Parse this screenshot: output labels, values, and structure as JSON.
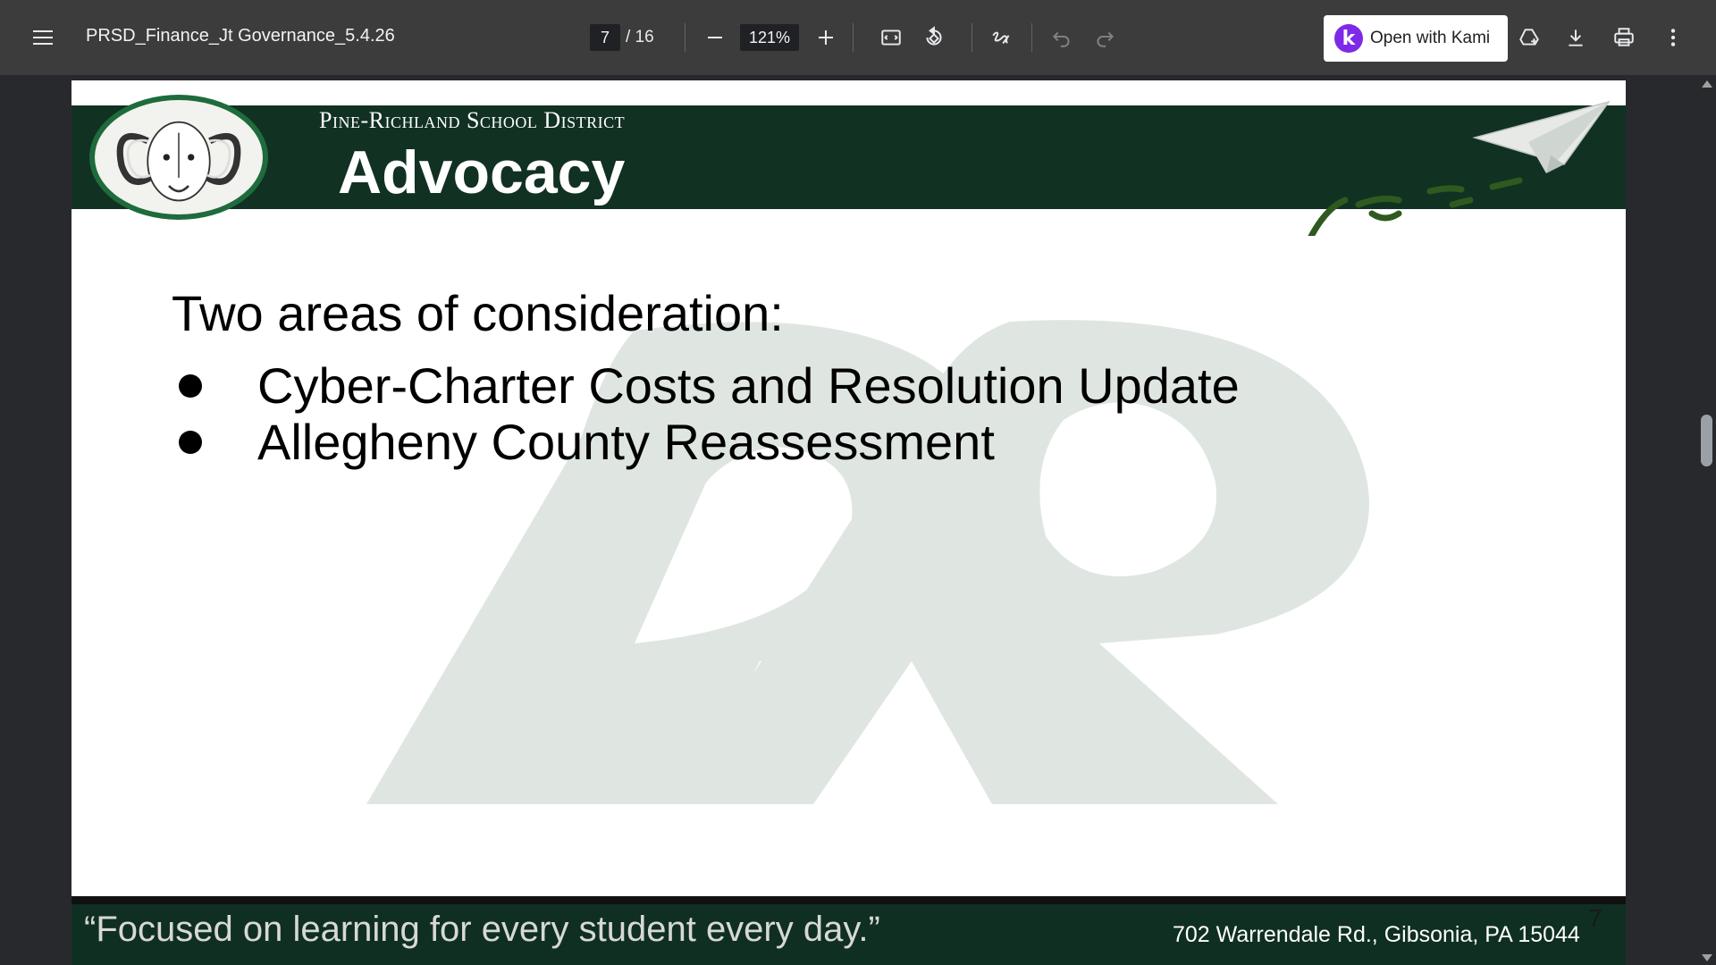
{
  "toolbar": {
    "document_title": "PRSD_Finance_Jt Governance_5.4.26",
    "current_page": "7",
    "page_total": "/ 16",
    "zoom": "121%",
    "open_with_label": "Open with Kami",
    "kami_logo_letter": "k"
  },
  "slide": {
    "district": "Pine-Richland School District",
    "title": "Advocacy",
    "heading": "Two areas of consideration:",
    "bullets": [
      "Cyber-Charter Costs and Resolution Update",
      "Allegheny County Reassessment"
    ],
    "motto": "“Focused on learning for every student every day.”",
    "address": "702 Warrendale Rd., Gibsonia, PA 15044",
    "page_number": "7"
  },
  "colors": {
    "toolbar_bg": "#3c3c3c",
    "banner_green": "#113123",
    "kami_purple": "#7d2ae8",
    "watermark": "#dfe6e2"
  },
  "icons": [
    "menu-icon",
    "zoom-out-icon",
    "zoom-in-icon",
    "fit-page-icon",
    "rotate-icon",
    "annotate-icon",
    "undo-icon",
    "redo-icon",
    "add-to-drive-icon",
    "download-icon",
    "print-icon",
    "more-options-icon"
  ]
}
